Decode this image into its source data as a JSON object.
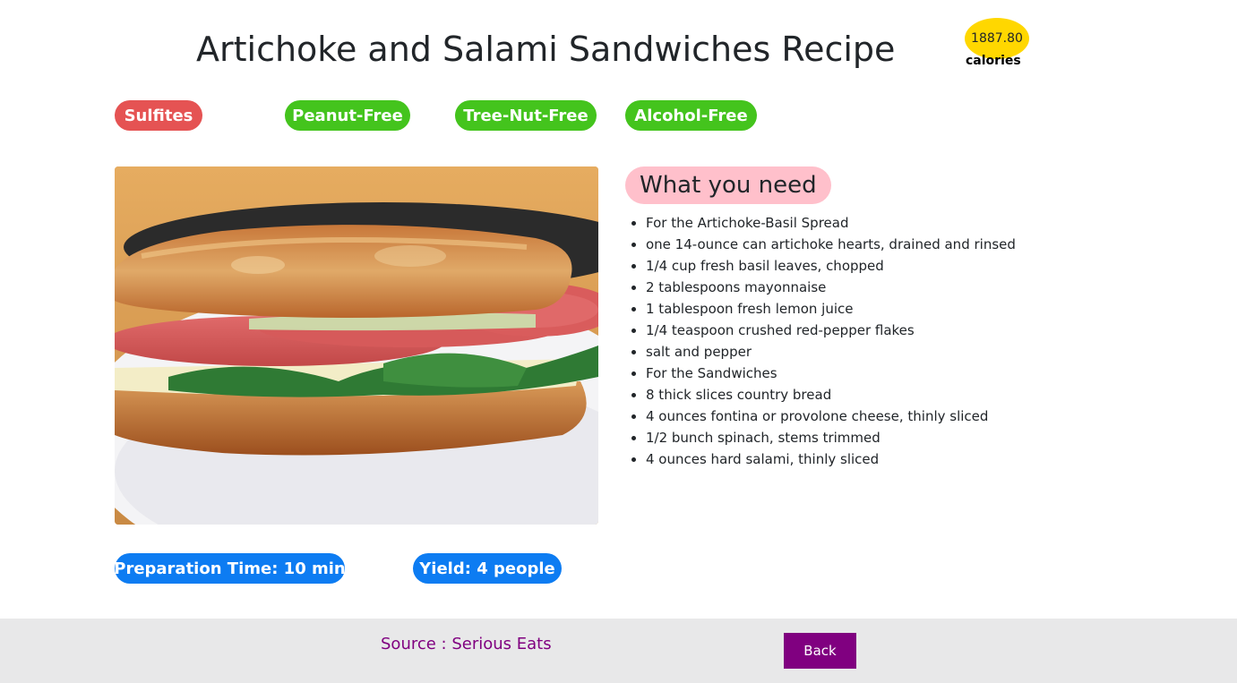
{
  "recipe": {
    "title": "Artichoke and Salami Sandwiches Recipe",
    "calories_value": "1887.80",
    "calories_label": "calories"
  },
  "tags": {
    "caution": [
      "Sulfites"
    ],
    "health": [
      "Peanut-Free",
      "Tree-Nut-Free",
      "Alcohol-Free"
    ]
  },
  "image": {
    "icon": "sandwich-photo"
  },
  "ingredients": {
    "heading": "What you need",
    "items": [
      "For the Artichoke-Basil Spread",
      "one 14-ounce can artichoke hearts, drained and rinsed",
      "1/4 cup fresh basil leaves, chopped",
      "2 tablespoons mayonnaise",
      "1 tablespoon fresh lemon juice",
      "1/4 teaspoon crushed red-pepper flakes",
      "salt and pepper",
      "For the Sandwiches",
      "8 thick slices country bread",
      "4 ounces fontina or provolone cheese, thinly sliced",
      "1/2 bunch spinach, stems trimmed",
      "4 ounces hard salami, thinly sliced"
    ]
  },
  "info": {
    "prep_time": "Preparation Time: 10 min",
    "yield": "Yield: 4 people"
  },
  "footer": {
    "source": "Source : Serious Eats",
    "back_label": "Back"
  },
  "colors": {
    "caution_tag": "#e55353",
    "health_tag": "#44c41d",
    "info_tag": "#0d7cf2",
    "calorie_badge": "#ffd700",
    "heading_bg": "#ffc0cb",
    "accent": "#800080",
    "footer_bg": "#e8e8e9"
  }
}
